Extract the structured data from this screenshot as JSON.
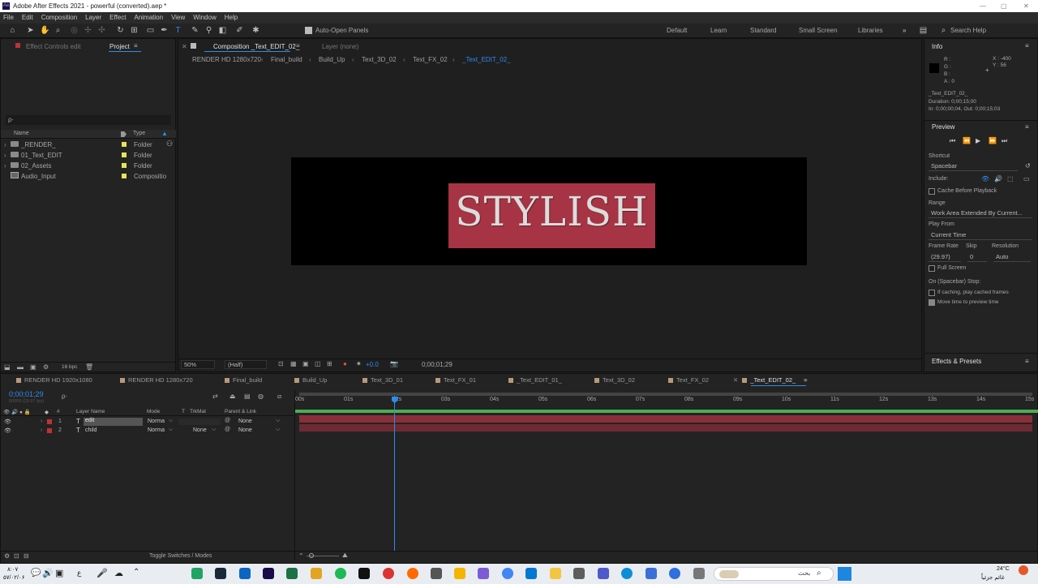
{
  "title": "Adobe After Effects 2021 - powerful (converted).aep *",
  "window_controls": {
    "min": "—",
    "max": "▢",
    "close": "✕"
  },
  "menu": [
    "File",
    "Edit",
    "Composition",
    "Layer",
    "Effect",
    "Animation",
    "View",
    "Window",
    "Help"
  ],
  "toolbar": {
    "auto_open": "Auto-Open Panels",
    "workspaces": [
      "Default",
      "Learn",
      "Standard",
      "Small Screen",
      "Libraries"
    ],
    "more": "»",
    "search": "Search Help"
  },
  "project": {
    "tab_effect_controls": "Effect Controls edit",
    "tab_project": "Project",
    "search_placeholder": "ρ·",
    "col_name": "Name",
    "col_type": "Type",
    "items": [
      {
        "name": "_RENDER_",
        "type": "Folder"
      },
      {
        "name": "01_Text_EDIT",
        "type": "Folder"
      },
      {
        "name": "02_Assets",
        "type": "Folder"
      },
      {
        "name": "Audio_Input",
        "type": "Compositio"
      }
    ],
    "bpc": "16 bpc"
  },
  "comp": {
    "tab": "Composition _Text_EDIT_02_",
    "layer_tab": "Layer (none)",
    "breadcrumbs": [
      "RENDER HD 1280x720",
      "Final_build",
      "Build_Up",
      "Text_3D_02",
      "Text_FX_02",
      "_Text_EDIT_02_"
    ],
    "headline": "STYLISH",
    "zoom": "50%",
    "quality": "(Half)",
    "exposure": "+0.0",
    "timecode": "0;00;01;29"
  },
  "info": {
    "title": "Info",
    "r": "R :",
    "g": "G :",
    "b": "B :",
    "a": "A : 0",
    "x": "X : -400",
    "y": "Y : 56",
    "comp_name": "_Text_EDIT_02_",
    "duration": "Duration: 0;00;15;00",
    "inout": "In: 0;00;00;04, Out: 0;00;15;03"
  },
  "preview": {
    "title": "Preview",
    "shortcut_label": "Shortcut",
    "shortcut": "Spacebar",
    "include": "Include:",
    "cache": "Cache Before Playback",
    "range_label": "Range",
    "range": "Work Area Extended By Current...",
    "play_from_label": "Play From",
    "play_from": "Current Time",
    "frame_rate_label": "Frame Rate",
    "skip_label": "Skip",
    "resolution_label": "Resolution",
    "frame_rate": "(29.97)",
    "skip": "0",
    "resolution": "Auto",
    "full_screen": "Full Screen",
    "stop_label": "On (Spacebar) Stop:",
    "if_caching": "If caching, play cached frames",
    "move_time": "Move time to preview time"
  },
  "effects": {
    "title": "Effects & Presets"
  },
  "timeline": {
    "tabs": [
      "RENDER HD 1920x1080",
      "RENDER HD 1280x720",
      "Final_build",
      "Build_Up",
      "Text_3D_01",
      "Text_FX_01",
      "_Text_EDIT_01_",
      "Text_3D_02",
      "Text_FX_02",
      "_Text_EDIT_02_"
    ],
    "timecode": "0;00;01;29",
    "frames": "00059 (29.97 fps)",
    "cols": {
      "num": "#",
      "layer": "Layer Name",
      "mode": "Mode",
      "t": "T",
      "trkmat": "TrkMat",
      "parent": "Parent & Link"
    },
    "layers": [
      {
        "num": "1",
        "type": "T",
        "name": "edit",
        "mode": "Norma",
        "trk": "",
        "parent": "None"
      },
      {
        "num": "2",
        "type": "T",
        "name": "child",
        "mode": "Norma",
        "trk": "None",
        "parent": "None"
      }
    ],
    "ticks": [
      "00s",
      "01s",
      "02s",
      "03s",
      "04s",
      "05s",
      "06s",
      "07s",
      "08s",
      "09s",
      "10s",
      "11s",
      "12s",
      "13s",
      "14s",
      "15s"
    ],
    "playhead_seconds": 1.97,
    "duration_seconds": 15,
    "toggle": "Toggle Switches / Modes"
  },
  "taskbar": {
    "time": "۸:۰۷",
    "date": "۵۷/۰۲/۰۶",
    "search": "بحث",
    "weather_temp": "24°C",
    "weather_text": "غائم جزئياً",
    "lang": "ع"
  },
  "colors": {
    "accent": "#2d8ceb",
    "layer_bar": "#8a2f3a",
    "work_area": "#4caf50",
    "headline_bg": "#a63444"
  }
}
